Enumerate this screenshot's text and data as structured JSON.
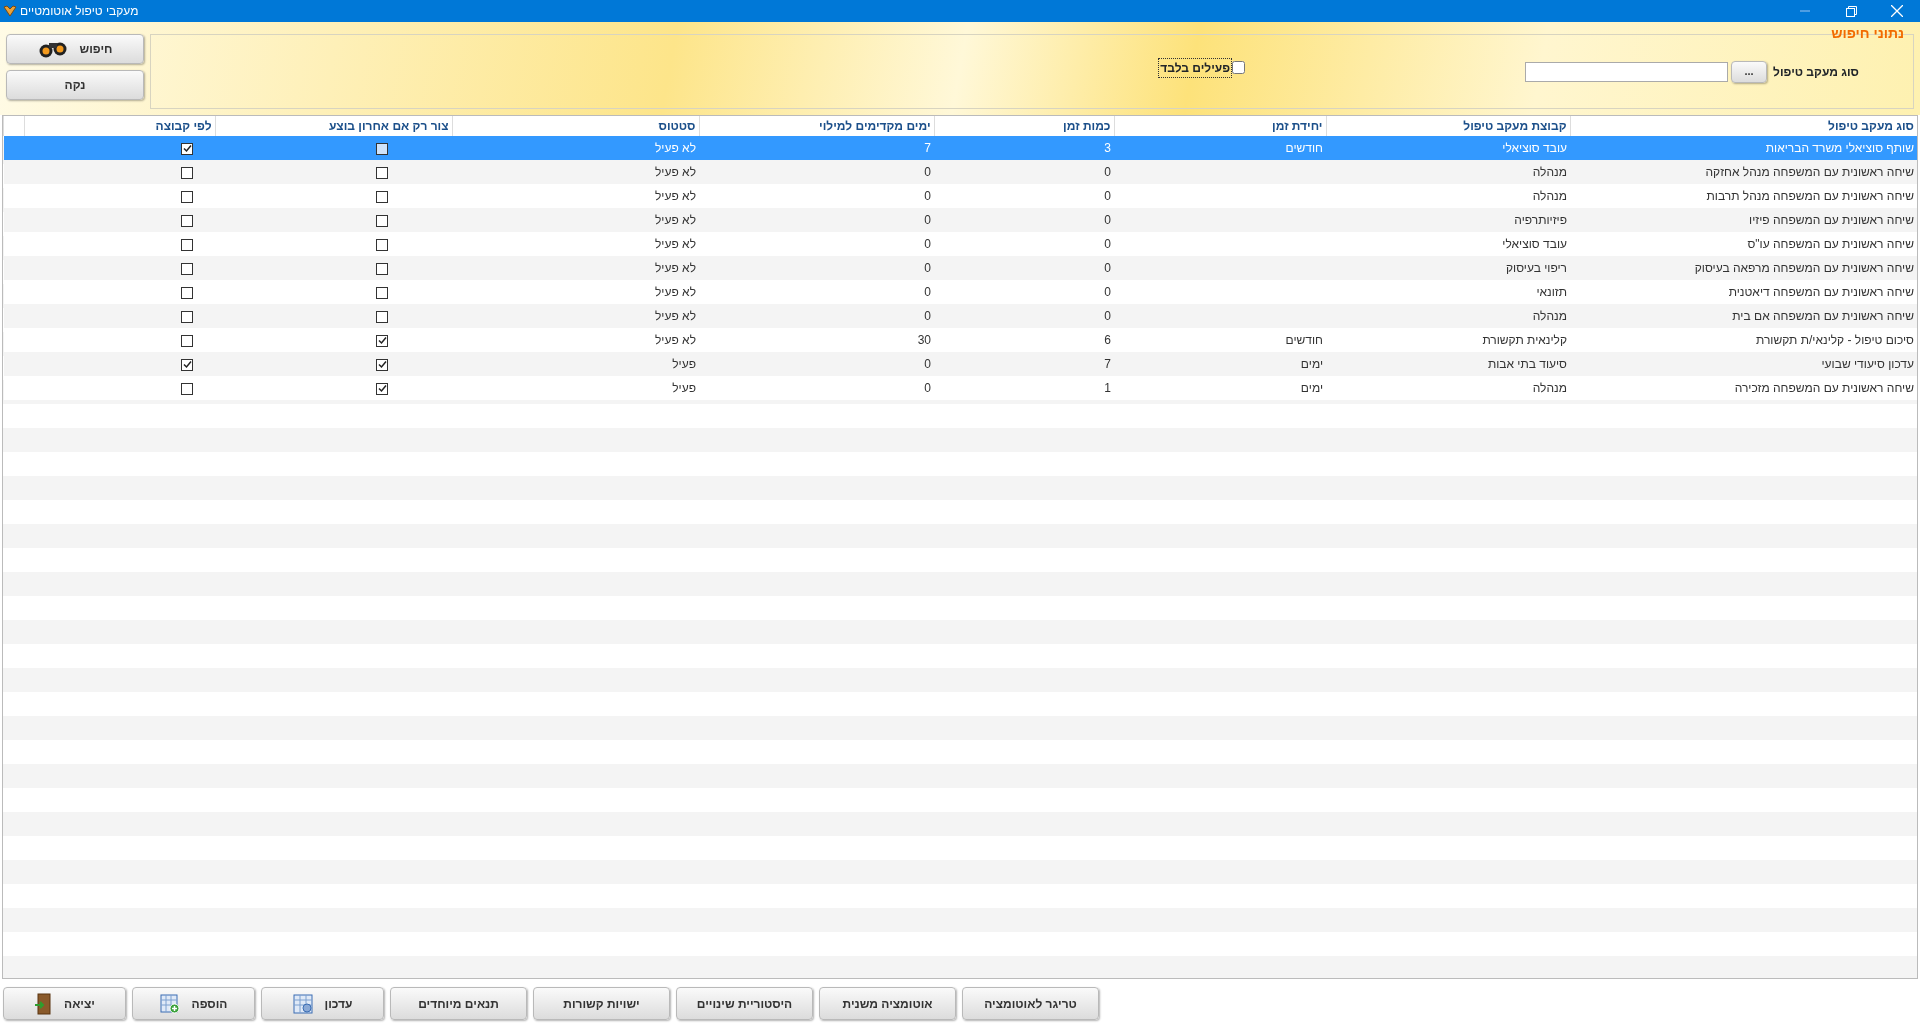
{
  "window": {
    "title": "מעקבי טיפול אוטומטיים"
  },
  "search": {
    "legend": "נתוני חיפוש",
    "type_label": "סוג מעקב טיפול",
    "browse_button": "...",
    "active_only": {
      "label": "פעילים בלבד",
      "checked": false
    }
  },
  "actions": [
    {
      "label": "חיפוש",
      "kind": "search"
    },
    {
      "label": "נקה",
      "kind": "plain"
    }
  ],
  "table": {
    "columns": [
      {
        "label": "סוג מעקב טיפול",
        "kind": "text"
      },
      {
        "label": "קבוצת מעקב טיפול",
        "kind": "text"
      },
      {
        "label": "יחידת זמן",
        "kind": "text"
      },
      {
        "label": "כמות זמן",
        "kind": "text"
      },
      {
        "label": "ימים מקדימים למילוי",
        "kind": "text"
      },
      {
        "label": "סטטוס",
        "kind": "text"
      },
      {
        "label": "צור רק אם אחרון בוצע",
        "kind": "check"
      },
      {
        "label": "לפי קבוצה",
        "kind": "check"
      }
    ],
    "rows": [
      {
        "selected": true,
        "type": "שותף סוציאלי משרד הבריאות",
        "group": "עובד סוציאלי",
        "time_unit": "חודשים",
        "time_amount": "3",
        "days_ahead": "7",
        "status": "לא פעיל",
        "only_if_last_done": false,
        "by_group": true
      },
      {
        "selected": false,
        "type": "שיחה ראשונית עם המשפחה מנהל אחזקה",
        "group": "מנהלה",
        "time_amount": "0",
        "days_ahead": "0",
        "status": "לא פעיל",
        "only_if_last_done": false,
        "by_group": false
      },
      {
        "selected": false,
        "type": "שיחה ראשונית עם המשפחה מנהל תרבות",
        "group": "מנהלה",
        "time_amount": "0",
        "days_ahead": "0",
        "status": "לא פעיל",
        "only_if_last_done": false,
        "by_group": false
      },
      {
        "selected": false,
        "type": "שיחה ראשונית עם המשפחה פיזיו",
        "group": "פיזיותרפיה",
        "time_amount": "0",
        "days_ahead": "0",
        "status": "לא פעיל",
        "only_if_last_done": false,
        "by_group": false
      },
      {
        "selected": false,
        "type": "שיחה ראשונית עם המשפחה עו\"ס",
        "group": "עובד סוציאלי",
        "time_amount": "0",
        "days_ahead": "0",
        "status": "לא פעיל",
        "only_if_last_done": false,
        "by_group": false
      },
      {
        "selected": false,
        "type": "שיחה ראשונית עם המשפחה מרפאה בעיסוק",
        "group": "ריפוי בעיסוק",
        "time_amount": "0",
        "days_ahead": "0",
        "status": "לא פעיל",
        "only_if_last_done": false,
        "by_group": false
      },
      {
        "selected": false,
        "type": "שיחה ראשונית עם המשפחה דיאטנית",
        "group": "תזונאי",
        "time_amount": "0",
        "days_ahead": "0",
        "status": "לא פעיל",
        "only_if_last_done": false,
        "by_group": false
      },
      {
        "selected": false,
        "type": "שיחה ראשונית עם המשפחה אם בית",
        "group": "מנהלה",
        "time_amount": "0",
        "days_ahead": "0",
        "status": "לא פעיל",
        "only_if_last_done": false,
        "by_group": false
      },
      {
        "selected": false,
        "type": "סיכום טיפול - קלינאי/ת תקשורת",
        "group": "קלינאית תקשורת",
        "time_unit": "חודשים",
        "time_amount": "6",
        "days_ahead": "30",
        "status": "לא פעיל",
        "only_if_last_done": true,
        "by_group": false
      },
      {
        "selected": false,
        "type": "עדכון סיעודי שבועי",
        "group": "סיעוד בתי אבות",
        "time_unit": "ימים",
        "time_amount": "7",
        "days_ahead": "0",
        "status": "פעיל",
        "only_if_last_done": true,
        "by_group": true
      },
      {
        "selected": false,
        "type": "שיחה ראשונית עם המשפחה מזכירה",
        "group": "מנהלה",
        "time_unit": "ימים",
        "time_amount": "1",
        "days_ahead": "0",
        "status": "פעיל",
        "only_if_last_done": true,
        "by_group": false
      }
    ]
  },
  "buttons": [
    {
      "label": "טריגר לאוטומציה",
      "kind": "plain"
    },
    {
      "label": "אוטומציה משנית",
      "kind": "plain"
    },
    {
      "label": "היסטוריית שינויים",
      "kind": "plain"
    },
    {
      "label": "ישויות קשורות",
      "kind": "plain"
    },
    {
      "label": "תנאים מיוחדים",
      "kind": "plain"
    },
    {
      "label": "עדכון",
      "kind": "update"
    },
    {
      "label": "הוספה",
      "kind": "add"
    },
    {
      "label": "יציאה",
      "kind": "exit"
    }
  ]
}
